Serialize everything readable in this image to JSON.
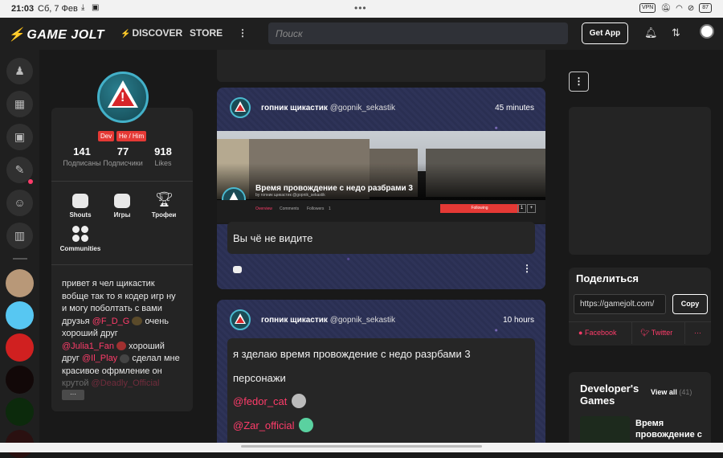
{
  "status_bar": {
    "time": "21:03",
    "date": "Сб, 7 Фев",
    "vpn": "VPN",
    "battery": "87"
  },
  "topnav": {
    "logo": "GAME JOLT",
    "discover": "DISCOVER",
    "store": "STORE",
    "search_placeholder": "Поиск",
    "get_app": "Get App"
  },
  "profile": {
    "badges": [
      "Dev",
      "He / Him"
    ],
    "stats": [
      {
        "value": "141",
        "label": "Подписаны"
      },
      {
        "value": "77",
        "label": "Подписчики"
      },
      {
        "value": "918",
        "label": "Likes"
      }
    ],
    "buttons": [
      {
        "label": "Shouts"
      },
      {
        "label": "Игры"
      },
      {
        "label": "Трофеи"
      },
      {
        "label": "Communities"
      }
    ],
    "bio_lines": [
      "привет я чел щикастик",
      "вобще так то я кодер игр ну",
      "и могу поболтать с вами",
      "хороший друг",
      "сделал мне",
      "красивое офрмление он",
      "крутой"
    ],
    "bio_intro": "друзья",
    "bio_mention_1": "@F_D_G",
    "bio_after_1": "очень",
    "bio_mention_2": "@Julia1_Fan",
    "bio_after_2": "хороший",
    "bio_friend": "друг",
    "bio_mention_3": "@Il_Play",
    "bio_mention_4": "@Deadly_Official",
    "more": "···"
  },
  "posts": [
    {
      "author": "гопник щикастик",
      "handle": "@gopnik_sekastik",
      "time": "45 minutes",
      "screenshot": {
        "title": "Время провождение с недо разбрами 3",
        "subtitle": "by гопник щикастик @gopnik_sekastik",
        "tabs": [
          "Overview",
          "Comments",
          "Followers"
        ],
        "followers_count": "1",
        "follow_label": "Following",
        "follow_count": "1"
      },
      "text": "Вы чё не видите"
    },
    {
      "author": "гопник щикастик",
      "handle": "@gopnik_sekastik",
      "time": "10 hours",
      "text_lines": [
        "я зделаю время провождение с недо разрбами 3",
        "персонажи"
      ],
      "mentions": [
        "@fedor_cat",
        "@Zar_official"
      ]
    }
  ],
  "share": {
    "title": "Поделиться",
    "url": "https://gamejolt.com/",
    "copy": "Copy",
    "facebook": "Facebook",
    "twitter": "Twitter",
    "more": "···"
  },
  "dev_games": {
    "title": "Developer's Games",
    "view_all": "View all",
    "count": "(41)",
    "game_name": "Время провождение с"
  },
  "colors": {
    "accent": "#ff3c6a",
    "badge": "#e53935",
    "background": "#191919",
    "card": "#242424"
  }
}
